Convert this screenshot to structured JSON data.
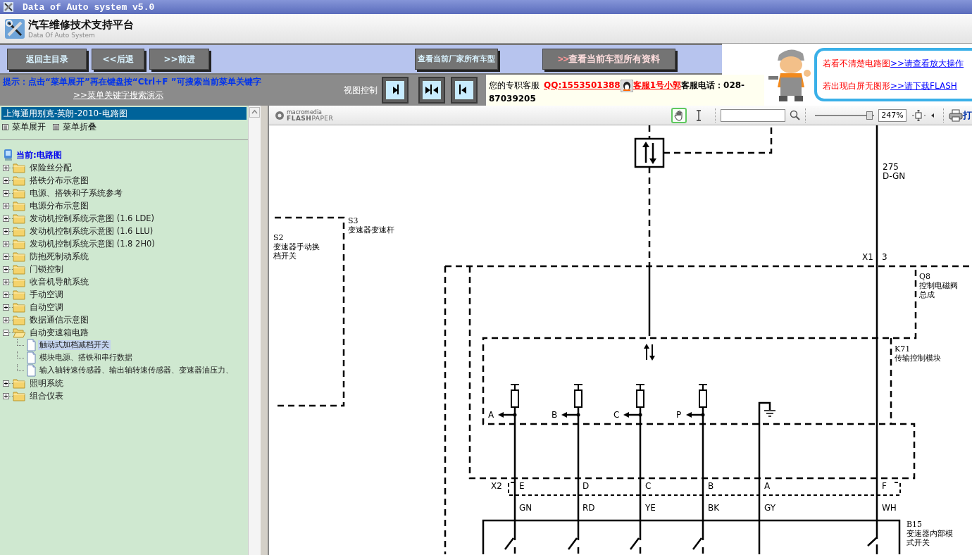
{
  "window": {
    "title": "Data of Auto system v5.0"
  },
  "header": {
    "title": "汽车维修技术支持平台",
    "subtitle": "Data Of Auto System"
  },
  "nav_buttons": [
    "返回主目录",
    "<<后退",
    ">>前进"
  ],
  "maker_button": "查看当前厂家所有车型",
  "model_button": {
    "arrow": ">>",
    "label": "查看当前车型所有资料"
  },
  "hint": {
    "text": "提示：点击“菜单展开”再在键盘按“Ctrl+F ”可搜索当前菜单关键字",
    "link": ">>菜单关键字搜索演示"
  },
  "view_control": {
    "label": "视图控制",
    "buttons": [
      {
        "kind": "right"
      },
      {
        "kind": "both"
      },
      {
        "kind": "left"
      }
    ]
  },
  "contact": {
    "label": "您的专职客服",
    "qq": "QQ:1553501388",
    "agent": "客服1号小郭",
    "phone": "客服电话：028-87039205"
  },
  "notices": [
    {
      "text": "若看不清楚电路图",
      "link": ">>请查看放大操作"
    },
    {
      "text": "若出现白屏无图形",
      "link": ">>请下载FLASH"
    }
  ],
  "sidebar": {
    "title": "上海通用别克-英朗-2010-电路图",
    "actions": [
      "菜单展开",
      "菜单折叠"
    ],
    "tree": {
      "label": "当前:电路图",
      "children": [
        {
          "label": "保险丝分配",
          "expanded": false
        },
        {
          "label": "搭铁分布示意图",
          "expanded": false
        },
        {
          "label": "电源、搭铁和子系统参考",
          "expanded": false
        },
        {
          "label": "电源分布示意图",
          "expanded": false
        },
        {
          "label": "发动机控制系统示意图 (1.6 LDE)",
          "expanded": false
        },
        {
          "label": "发动机控制系统示意图 (1.6 LLU)",
          "expanded": false
        },
        {
          "label": "发动机控制系统示意图 (1.8 2H0)",
          "expanded": false
        },
        {
          "label": "防抱死制动系统",
          "expanded": false
        },
        {
          "label": "门锁控制",
          "expanded": false
        },
        {
          "label": "收音机导航系统",
          "expanded": false
        },
        {
          "label": "手动空调",
          "expanded": false
        },
        {
          "label": "自动空调",
          "expanded": false
        },
        {
          "label": "数据通信示意图",
          "expanded": false
        },
        {
          "label": "自动变速箱电路",
          "expanded": true,
          "children": [
            {
              "label": "触动式加档减档开关",
              "selected": true
            },
            {
              "label": "模块电源、搭铁和串行数据",
              "selected": false
            },
            {
              "label": "输入轴转速传感器、输出轴转速传感器、变速器油压力、",
              "selected": false
            }
          ]
        },
        {
          "label": "照明系统",
          "expanded": false
        },
        {
          "label": "组合仪表",
          "expanded": false
        }
      ]
    }
  },
  "viewer": {
    "logo_top": "macromedia",
    "logo_bottom": "**FLASH**PAPER",
    "tools": [
      {
        "kind": "hand",
        "selected": true
      },
      {
        "kind": "text",
        "selected": false
      }
    ],
    "zoom": {
      "level": 0.93,
      "reading": "247%"
    },
    "print_label": "打"
  },
  "diagram": {
    "components": [
      {
        "ref": "S3",
        "name": [
          "变速器变速杆"
        ]
      },
      {
        "ref": "S2",
        "name": [
          "变速器手动换",
          "档开关"
        ]
      },
      {
        "ref": "Q8",
        "name": [
          "控制电磁阀",
          "总成"
        ]
      },
      {
        "ref": "K71",
        "name": [
          "传输控制模块"
        ]
      },
      {
        "ref": "B15",
        "name": [
          "变速器内部模",
          "式开关"
        ]
      }
    ],
    "wire": {
      "circuit": "275",
      "code": "D-GN"
    },
    "connectors": [
      {
        "ref": "X1",
        "pins": [
          "3"
        ]
      },
      {
        "ref": "X2",
        "pins": [
          "E",
          "D",
          "C",
          "B",
          "A",
          "F"
        ]
      }
    ],
    "outputs": [
      "A",
      "B",
      "C",
      "P"
    ],
    "wire_colors": [
      "GN",
      "RD",
      "YE",
      "BK",
      "GY",
      "WH"
    ]
  }
}
